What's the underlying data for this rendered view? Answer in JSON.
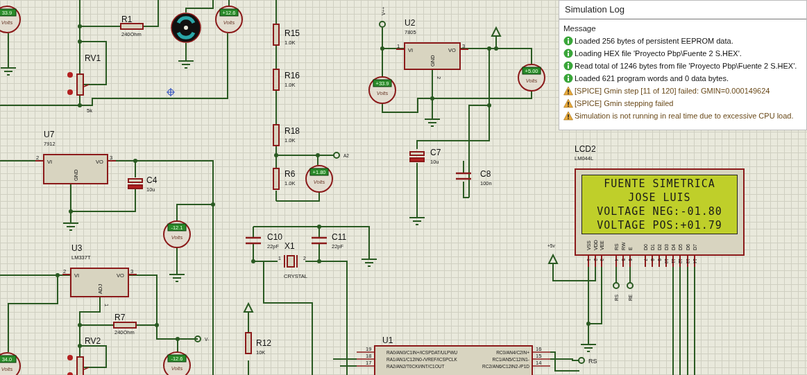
{
  "simulation_log": {
    "title": "Simulation Log",
    "column_header": "Message",
    "messages": [
      {
        "kind": "info",
        "text": "Loaded 256 bytes of persistent EEPROM data."
      },
      {
        "kind": "info",
        "text": "Loading HEX file 'Proyecto Pbp\\Fuente 2 S.HEX'."
      },
      {
        "kind": "info",
        "text": "Read total of 1246 bytes from file 'Proyecto Pbp\\Fuente 2 S.HEX'."
      },
      {
        "kind": "info",
        "text": "Loaded 621 program words and 0 data bytes."
      },
      {
        "kind": "warning",
        "text": "[SPICE] Gmin step [11 of 120] failed: GMIN=0.000149624"
      },
      {
        "kind": "warning",
        "text": "[SPICE] Gmin stepping failed"
      },
      {
        "kind": "warning",
        "text": "Simulation is not running in real time due to excessive CPU load."
      }
    ]
  },
  "resistors": [
    {
      "ref": "R1",
      "value": "240Ohm"
    },
    {
      "ref": "R15",
      "value": "1.0K"
    },
    {
      "ref": "R16",
      "value": "1.0K"
    },
    {
      "ref": "R18",
      "value": "1.0K"
    },
    {
      "ref": "R6",
      "value": "1.0K"
    },
    {
      "ref": "R7",
      "value": "240Ohm"
    },
    {
      "ref": "R12",
      "value": "10K"
    }
  ],
  "potentiometers": [
    {
      "ref": "RV1",
      "value": "5k"
    },
    {
      "ref": "RV2"
    }
  ],
  "capacitors": [
    {
      "ref": "C4",
      "value": "10u",
      "polarized": true
    },
    {
      "ref": "C7",
      "value": "10u",
      "polarized": true
    },
    {
      "ref": "C8",
      "value": "100n",
      "polarized": false
    },
    {
      "ref": "C10",
      "value": "22pF",
      "polarized": false
    },
    {
      "ref": "C11",
      "value": "22pF",
      "polarized": false
    }
  ],
  "regulators": [
    {
      "ref": "U7",
      "part": "7912",
      "in_label": "VI",
      "out_label": "VO",
      "common_label": "GND",
      "pin_numbers": [
        "2",
        "3"
      ]
    },
    {
      "ref": "U2",
      "part": "7805",
      "in_label": "VI",
      "out_label": "VO",
      "common_label": "GND",
      "pin_numbers": [
        "1",
        "3",
        "2"
      ]
    },
    {
      "ref": "U3",
      "part": "LM337T",
      "in_label": "VI",
      "out_label": "VO",
      "common_label": "ADJ",
      "pin_numbers": [
        "2",
        "3",
        "1"
      ]
    }
  ],
  "crystal": {
    "ref": "X1",
    "value": "CRYSTAL",
    "pin_numbers": [
      "1",
      "2"
    ]
  },
  "meters": [
    {
      "reading": "33.9",
      "unit": "Volts"
    },
    {
      "reading": "+12.6",
      "unit": "Volts"
    },
    {
      "reading": "+33.9",
      "unit": "Volts"
    },
    {
      "reading": "+5.00",
      "unit": "Volts"
    },
    {
      "reading": "+1.80",
      "unit": "Volts"
    },
    {
      "reading": "-12.1",
      "unit": "Volts"
    },
    {
      "reading": "-12.6",
      "unit": "Volts"
    },
    {
      "reading": "34.0",
      "unit": "Volts"
    }
  ],
  "terminals": [
    {
      "label": "V++"
    },
    {
      "label": "A2"
    },
    {
      "label": "V-"
    },
    {
      "label": "+5v"
    },
    {
      "label": "RS"
    },
    {
      "label": "RE"
    },
    {
      "label": "RS"
    }
  ],
  "mcu": {
    "ref": "U1",
    "rows": [
      {
        "left_pin": "19",
        "left": "RA0/AN0/C1IN+/ICSPDAT/ULPWU",
        "right": "RC0/AN4/C2IN+",
        "right_pin": "16"
      },
      {
        "left_pin": "18",
        "left": "RA1/AN1/C12IN0-/VREF/ICSPCLK",
        "right": "RC1/AN5/C12IN1-",
        "right_pin": "15"
      },
      {
        "left_pin": "17",
        "left": "RA2/AN2/T0CKI/INT/C1OUT",
        "right": "RC2/AN6/C12IN2-/P1D",
        "right_pin": "14"
      }
    ]
  },
  "lcd": {
    "ref": "LCD2",
    "part": "LM044L",
    "lines": [
      "FUENTE SIMETRICA",
      "JOSE LUIS",
      "VOLTAGE NEG:-01.80",
      "VOLTAGE POS:+01.79"
    ],
    "pins": [
      {
        "name": "VSS",
        "number": "1"
      },
      {
        "name": "VDD",
        "number": "2"
      },
      {
        "name": "VEE",
        "number": "3"
      },
      {
        "name": "RS",
        "number": "4"
      },
      {
        "name": "RW",
        "number": "5"
      },
      {
        "name": "E",
        "number": "6"
      },
      {
        "name": "D0",
        "number": "7"
      },
      {
        "name": "D1",
        "number": "8"
      },
      {
        "name": "D2",
        "number": "9"
      },
      {
        "name": "D3",
        "number": "10"
      },
      {
        "name": "D4",
        "number": "11"
      },
      {
        "name": "D5",
        "number": "12"
      },
      {
        "name": "D6",
        "number": "13"
      },
      {
        "name": "D7",
        "number": "14"
      }
    ]
  }
}
